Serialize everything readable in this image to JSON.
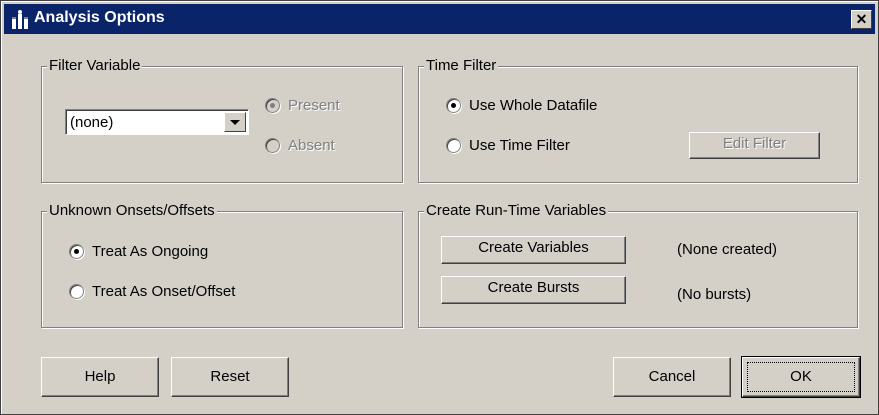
{
  "window": {
    "title": "Analysis Options",
    "close_label": "✕"
  },
  "filter_variable": {
    "legend": "Filter Variable",
    "selected": "(none)",
    "present_label": "Present",
    "absent_label": "Absent"
  },
  "time_filter": {
    "legend": "Time Filter",
    "use_whole_label": "Use Whole Datafile",
    "use_filter_label": "Use Time Filter",
    "edit_filter_label": "Edit Filter"
  },
  "unknown": {
    "legend": "Unknown Onsets/Offsets",
    "ongoing_label": "Treat As Ongoing",
    "onset_offset_label": "Treat As Onset/Offset"
  },
  "runtime": {
    "legend": "Create Run-Time Variables",
    "create_variables_label": "Create Variables",
    "variables_status": "(None created)",
    "create_bursts_label": "Create Bursts",
    "bursts_status": "(No bursts)"
  },
  "footer": {
    "help_label": "Help",
    "reset_label": "Reset",
    "cancel_label": "Cancel",
    "ok_label": "OK"
  }
}
